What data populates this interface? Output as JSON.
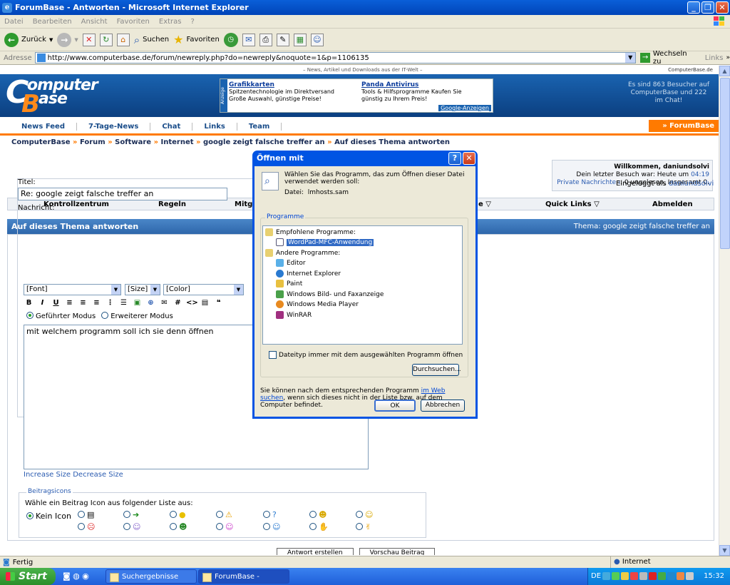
{
  "window": {
    "title": "ForumBase - Antworten - Microsoft Internet Explorer"
  },
  "menu": [
    "Datei",
    "Bearbeiten",
    "Ansicht",
    "Favoriten",
    "Extras",
    "?"
  ],
  "toolbar": {
    "back": "Zurück",
    "search": "Suchen",
    "favorites": "Favoriten"
  },
  "address": {
    "label": "Adresse",
    "url": "http://www.computerbase.de/forum/newreply.php?do=newreply&noquote=1&p=1106135",
    "go": "Wechseln zu",
    "links": "Links"
  },
  "site": {
    "tagline": "– News, Artikel und Downloads aus der IT-Welt –",
    "domain": "ComputerBase.de",
    "logo_top": "omputer",
    "logo_bottom": "ase",
    "logo_c": "C",
    "logo_b": "B",
    "ad_label": "Anzeige",
    "ads": [
      {
        "title": "Grafikkarten",
        "line1": "Spitzentechnologie im Direktversand",
        "line2": "Große Auswahl, günstige Preise!"
      },
      {
        "title": "Panda Antivirus",
        "line1": "Tools & Hilfsprogramme Kaufen Sie",
        "line2": "günstig zu Ihrem Preis!"
      }
    ],
    "ad_footer": "Google-Anzeigen",
    "visitors": "Es sind 863 Besucher auf ComputerBase und 222 im Chat!",
    "nav": [
      "News Feed",
      "7-Tage-News",
      "Chat",
      "Links",
      "Team"
    ],
    "forumbase_tab": "» ForumBase"
  },
  "breadcrumb": {
    "items": [
      "ComputerBase",
      "Forum",
      "Software",
      "Internet",
      "google zeigt falsche treffer an",
      "Auf dieses Thema antworten"
    ],
    "sep": "»"
  },
  "welcome": {
    "line1": "Willkommen, daniundsolvi",
    "line2_prefix": "Dein letzter Besuch war: Heute um ",
    "line2_time": "04:19",
    "pm_label": "Private Nachrichten",
    "pm_value": ": 0 ungelesen, Insgesamt 0."
  },
  "controlbar": [
    "Kontrollzentrum",
    "Regeln",
    "Mitgl",
    "e ▽",
    "Quick Links ▽",
    "Abmelden"
  ],
  "panel": {
    "title": "Auf dieses Thema antworten",
    "topic_label": "Thema:",
    "topic_value": "google zeigt falsche treffer an",
    "logged_prefix": "Eingeloggt als ",
    "logged_user": "daniundsolvi"
  },
  "form": {
    "title_label": "Titel:",
    "title_value": "Re: google zeigt falsche treffer an",
    "message_label": "Nachricht:",
    "font": "[Font]",
    "size": "[Size]",
    "color": "[Color]",
    "mode1": "Geführter Modus",
    "mode2": "Erweiterer Modus",
    "message": "mit welchem programm soll ich sie denn öffnen",
    "increase": "Increase Size",
    "decrease": "Decrease Size",
    "icons_legend": "Beitragsicons",
    "icons_hint": "Wähle ein Beitrag Icon aus folgender Liste aus:",
    "no_icon": "Kein Icon",
    "submit": "Antwort erstellen",
    "preview": "Vorschau Beitrag"
  },
  "dialog": {
    "title": "Öffnen mit",
    "intro": "Wählen Sie das Programm, das zum Öffnen dieser Datei verwendet werden soll:",
    "file_label": "Datei:",
    "file_name": "lmhosts.sam",
    "group": "Programme",
    "recommended": "Empfohlene Programme:",
    "selected": "WordPad-MFC-Anwendung",
    "others": "Andere Programme:",
    "programs": [
      "Editor",
      "Internet Explorer",
      "Paint",
      "Windows Bild- und Faxanzeige",
      "Windows Media Player",
      "WinRAR"
    ],
    "checkbox": "Dateityp immer mit dem ausgewählten Programm öffnen",
    "browse": "Durchsuchen...",
    "footer_pre": "Sie können nach dem entsprechenden Programm ",
    "footer_link": "im Web suchen",
    "footer_post": ", wenn sich dieses nicht in der Liste bzw. auf dem Computer befindet.",
    "ok": "OK",
    "cancel": "Abbrechen"
  },
  "status": {
    "text": "Fertig",
    "zone": "Internet"
  },
  "taskbar": {
    "start": "Start",
    "tasks": [
      "Suchergebnisse",
      "ForumBase - Antwort..."
    ],
    "lang": "DE",
    "time": "15:32"
  }
}
